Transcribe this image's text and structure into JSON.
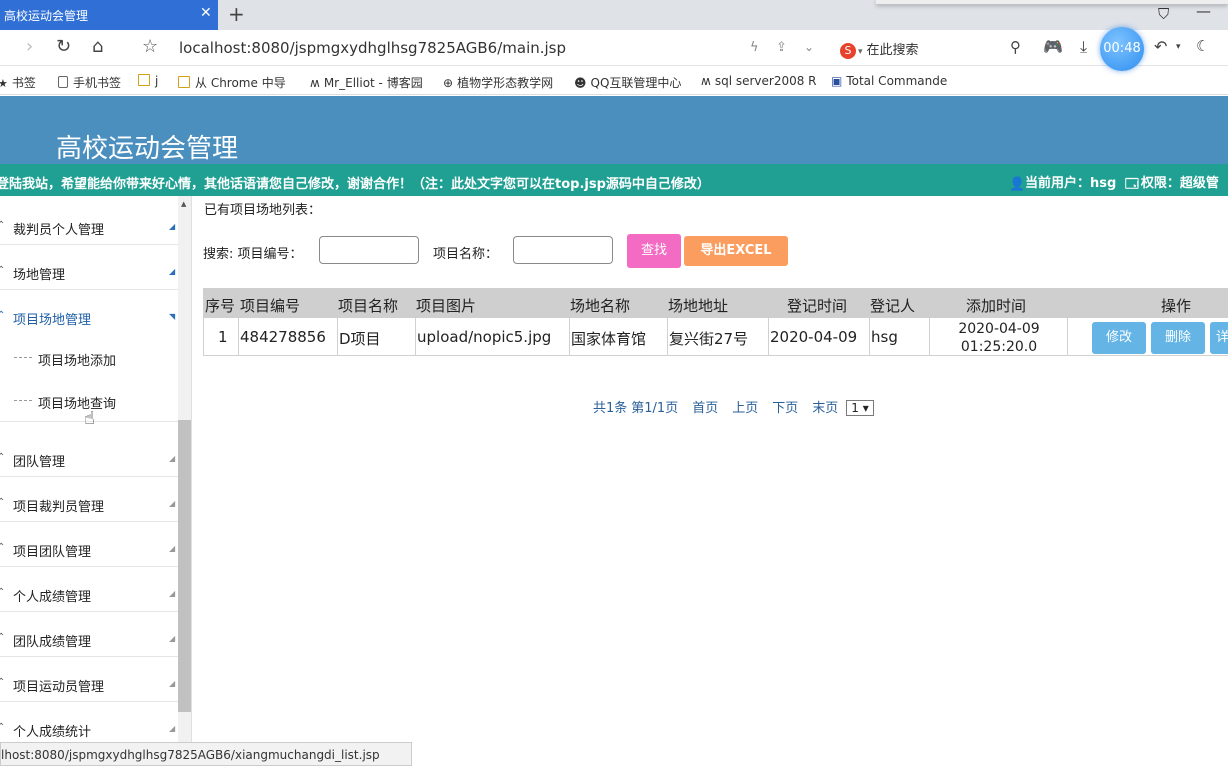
{
  "browser": {
    "tab_title": "高校运动会管理",
    "tab_close": "✕",
    "new_tab": "+",
    "url_host": "localhost",
    "url_rest": ":8080/jspmgxydhglhsg7825AGB6/main.jsp",
    "search_engine_label": "在此搜索",
    "timer": "00:48",
    "status_url": "lhost:8080/jspmgxydhglhsg7825AGB6/xiangmuchangdi_list.jsp"
  },
  "bookmarks": [
    {
      "label": "书签"
    },
    {
      "label": "手机书签"
    },
    {
      "label": "j"
    },
    {
      "label": "从 Chrome 中导"
    },
    {
      "label": "Mr_Elliot - 博客园"
    },
    {
      "label": "植物学形态教学网"
    },
    {
      "label": "QQ互联管理中心"
    },
    {
      "label": "sql server2008 R"
    },
    {
      "label": "Total Commande"
    }
  ],
  "app": {
    "title": "高校运动会管理",
    "marquee": "登陆我站，希望能给你带来好心情，其他话语请您自己修改，谢谢合作！（注：此处文字您可以在top.jsp源码中自己修改）",
    "user_label": "当前用户：hsg",
    "role_label": "权限：超级管"
  },
  "sidebar": {
    "items": [
      {
        "label": "裁判员个人管理"
      },
      {
        "label": "场地管理"
      },
      {
        "label": "项目场地管理"
      }
    ],
    "subitems": [
      {
        "label": "项目场地添加"
      },
      {
        "label": "项目场地查询"
      }
    ],
    "items_after": [
      {
        "label": "团队管理"
      },
      {
        "label": "项目裁判员管理"
      },
      {
        "label": "项目团队管理"
      },
      {
        "label": "个人成绩管理"
      },
      {
        "label": "团队成绩管理"
      },
      {
        "label": "项目运动员管理"
      },
      {
        "label": "个人成绩统计"
      }
    ]
  },
  "main": {
    "caption": "已有项目场地列表：",
    "search_prefix": "搜索: 项目编号：",
    "name_label": "项目名称：",
    "btn_search": "查找",
    "btn_excel": "导出EXCEL",
    "columns": [
      "序号",
      "项目编号",
      "项目名称",
      "项目图片",
      "场地名称",
      "场地地址",
      "登记时间",
      "登记人",
      "添加时间",
      "操作"
    ],
    "rows": [
      {
        "index": "1",
        "code": "484278856",
        "name": "D项目",
        "image": "upload/nopic5.jpg",
        "venue": "国家体育馆",
        "address": "复兴街27号",
        "reg_time": "2020-04-09",
        "registrar": "hsg",
        "add_time_date": "2020-04-09",
        "add_time_clock": "01:25:20.0",
        "op_edit": "修改",
        "op_delete": "删除",
        "op_detail": "详"
      }
    ],
    "pager": {
      "total": "共1条",
      "page": "第1/1页",
      "first": "首页",
      "prev": "上页",
      "next": "下页",
      "last": "末页",
      "select": "1 ▾"
    }
  }
}
